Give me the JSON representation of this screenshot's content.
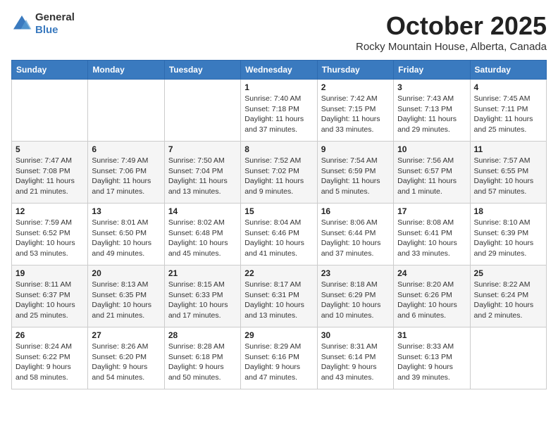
{
  "header": {
    "logo_general": "General",
    "logo_blue": "Blue",
    "month": "October 2025",
    "location": "Rocky Mountain House, Alberta, Canada"
  },
  "days_of_week": [
    "Sunday",
    "Monday",
    "Tuesday",
    "Wednesday",
    "Thursday",
    "Friday",
    "Saturday"
  ],
  "weeks": [
    [
      {
        "day": "",
        "sunrise": "",
        "sunset": "",
        "daylight": ""
      },
      {
        "day": "",
        "sunrise": "",
        "sunset": "",
        "daylight": ""
      },
      {
        "day": "",
        "sunrise": "",
        "sunset": "",
        "daylight": ""
      },
      {
        "day": "1",
        "sunrise": "Sunrise: 7:40 AM",
        "sunset": "Sunset: 7:18 PM",
        "daylight": "Daylight: 11 hours and 37 minutes."
      },
      {
        "day": "2",
        "sunrise": "Sunrise: 7:42 AM",
        "sunset": "Sunset: 7:15 PM",
        "daylight": "Daylight: 11 hours and 33 minutes."
      },
      {
        "day": "3",
        "sunrise": "Sunrise: 7:43 AM",
        "sunset": "Sunset: 7:13 PM",
        "daylight": "Daylight: 11 hours and 29 minutes."
      },
      {
        "day": "4",
        "sunrise": "Sunrise: 7:45 AM",
        "sunset": "Sunset: 7:11 PM",
        "daylight": "Daylight: 11 hours and 25 minutes."
      }
    ],
    [
      {
        "day": "5",
        "sunrise": "Sunrise: 7:47 AM",
        "sunset": "Sunset: 7:08 PM",
        "daylight": "Daylight: 11 hours and 21 minutes."
      },
      {
        "day": "6",
        "sunrise": "Sunrise: 7:49 AM",
        "sunset": "Sunset: 7:06 PM",
        "daylight": "Daylight: 11 hours and 17 minutes."
      },
      {
        "day": "7",
        "sunrise": "Sunrise: 7:50 AM",
        "sunset": "Sunset: 7:04 PM",
        "daylight": "Daylight: 11 hours and 13 minutes."
      },
      {
        "day": "8",
        "sunrise": "Sunrise: 7:52 AM",
        "sunset": "Sunset: 7:02 PM",
        "daylight": "Daylight: 11 hours and 9 minutes."
      },
      {
        "day": "9",
        "sunrise": "Sunrise: 7:54 AM",
        "sunset": "Sunset: 6:59 PM",
        "daylight": "Daylight: 11 hours and 5 minutes."
      },
      {
        "day": "10",
        "sunrise": "Sunrise: 7:56 AM",
        "sunset": "Sunset: 6:57 PM",
        "daylight": "Daylight: 11 hours and 1 minute."
      },
      {
        "day": "11",
        "sunrise": "Sunrise: 7:57 AM",
        "sunset": "Sunset: 6:55 PM",
        "daylight": "Daylight: 10 hours and 57 minutes."
      }
    ],
    [
      {
        "day": "12",
        "sunrise": "Sunrise: 7:59 AM",
        "sunset": "Sunset: 6:52 PM",
        "daylight": "Daylight: 10 hours and 53 minutes."
      },
      {
        "day": "13",
        "sunrise": "Sunrise: 8:01 AM",
        "sunset": "Sunset: 6:50 PM",
        "daylight": "Daylight: 10 hours and 49 minutes."
      },
      {
        "day": "14",
        "sunrise": "Sunrise: 8:02 AM",
        "sunset": "Sunset: 6:48 PM",
        "daylight": "Daylight: 10 hours and 45 minutes."
      },
      {
        "day": "15",
        "sunrise": "Sunrise: 8:04 AM",
        "sunset": "Sunset: 6:46 PM",
        "daylight": "Daylight: 10 hours and 41 minutes."
      },
      {
        "day": "16",
        "sunrise": "Sunrise: 8:06 AM",
        "sunset": "Sunset: 6:44 PM",
        "daylight": "Daylight: 10 hours and 37 minutes."
      },
      {
        "day": "17",
        "sunrise": "Sunrise: 8:08 AM",
        "sunset": "Sunset: 6:41 PM",
        "daylight": "Daylight: 10 hours and 33 minutes."
      },
      {
        "day": "18",
        "sunrise": "Sunrise: 8:10 AM",
        "sunset": "Sunset: 6:39 PM",
        "daylight": "Daylight: 10 hours and 29 minutes."
      }
    ],
    [
      {
        "day": "19",
        "sunrise": "Sunrise: 8:11 AM",
        "sunset": "Sunset: 6:37 PM",
        "daylight": "Daylight: 10 hours and 25 minutes."
      },
      {
        "day": "20",
        "sunrise": "Sunrise: 8:13 AM",
        "sunset": "Sunset: 6:35 PM",
        "daylight": "Daylight: 10 hours and 21 minutes."
      },
      {
        "day": "21",
        "sunrise": "Sunrise: 8:15 AM",
        "sunset": "Sunset: 6:33 PM",
        "daylight": "Daylight: 10 hours and 17 minutes."
      },
      {
        "day": "22",
        "sunrise": "Sunrise: 8:17 AM",
        "sunset": "Sunset: 6:31 PM",
        "daylight": "Daylight: 10 hours and 13 minutes."
      },
      {
        "day": "23",
        "sunrise": "Sunrise: 8:18 AM",
        "sunset": "Sunset: 6:29 PM",
        "daylight": "Daylight: 10 hours and 10 minutes."
      },
      {
        "day": "24",
        "sunrise": "Sunrise: 8:20 AM",
        "sunset": "Sunset: 6:26 PM",
        "daylight": "Daylight: 10 hours and 6 minutes."
      },
      {
        "day": "25",
        "sunrise": "Sunrise: 8:22 AM",
        "sunset": "Sunset: 6:24 PM",
        "daylight": "Daylight: 10 hours and 2 minutes."
      }
    ],
    [
      {
        "day": "26",
        "sunrise": "Sunrise: 8:24 AM",
        "sunset": "Sunset: 6:22 PM",
        "daylight": "Daylight: 9 hours and 58 minutes."
      },
      {
        "day": "27",
        "sunrise": "Sunrise: 8:26 AM",
        "sunset": "Sunset: 6:20 PM",
        "daylight": "Daylight: 9 hours and 54 minutes."
      },
      {
        "day": "28",
        "sunrise": "Sunrise: 8:28 AM",
        "sunset": "Sunset: 6:18 PM",
        "daylight": "Daylight: 9 hours and 50 minutes."
      },
      {
        "day": "29",
        "sunrise": "Sunrise: 8:29 AM",
        "sunset": "Sunset: 6:16 PM",
        "daylight": "Daylight: 9 hours and 47 minutes."
      },
      {
        "day": "30",
        "sunrise": "Sunrise: 8:31 AM",
        "sunset": "Sunset: 6:14 PM",
        "daylight": "Daylight: 9 hours and 43 minutes."
      },
      {
        "day": "31",
        "sunrise": "Sunrise: 8:33 AM",
        "sunset": "Sunset: 6:13 PM",
        "daylight": "Daylight: 9 hours and 39 minutes."
      },
      {
        "day": "",
        "sunrise": "",
        "sunset": "",
        "daylight": ""
      }
    ]
  ]
}
